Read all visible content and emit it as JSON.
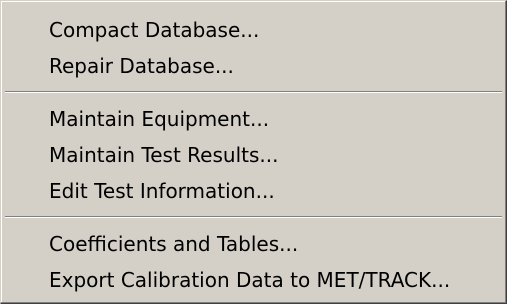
{
  "menu": {
    "groups": [
      {
        "items": [
          {
            "label": "Compact Database..."
          },
          {
            "label": "Repair Database..."
          }
        ]
      },
      {
        "items": [
          {
            "label": "Maintain Equipment..."
          },
          {
            "label": "Maintain Test Results..."
          },
          {
            "label": "Edit Test Information..."
          }
        ]
      },
      {
        "items": [
          {
            "label": "Coefficients and Tables..."
          },
          {
            "label": "Export Calibration Data to MET/TRACK..."
          }
        ]
      }
    ]
  }
}
